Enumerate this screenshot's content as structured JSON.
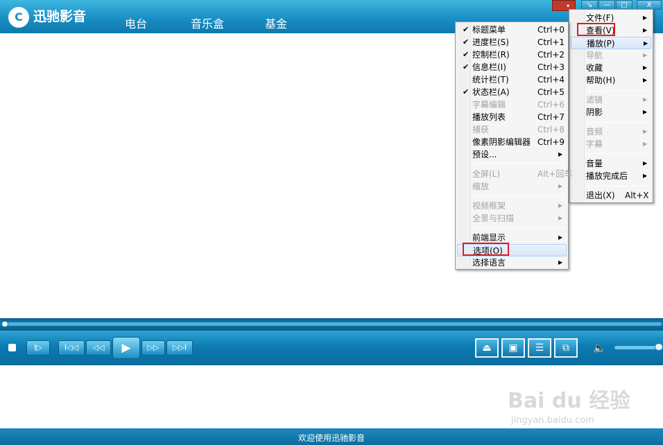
{
  "app": {
    "title": "迅驰影音",
    "logo_glyph": "C"
  },
  "nav": {
    "tabs": [
      "电台",
      "音乐盒",
      "基金"
    ]
  },
  "window_controls": {
    "menu": "▾",
    "restore": "↘",
    "minimize": "—",
    "maximize": "□",
    "close": "X"
  },
  "controls": {
    "step": "I▷",
    "prev": "I◁◁",
    "rewind": "◁◁",
    "play": "▶",
    "forward": "▷▷",
    "next": "▷▷I",
    "eject": "⏏",
    "snapshot": "▣",
    "playlist": "☰",
    "window": "⧉",
    "volume": "🔈"
  },
  "seek": {
    "position_fraction": 0.0
  },
  "volume_level": 0.85,
  "status": {
    "text": "欢迎使用迅驰影音"
  },
  "main_menu": {
    "items": [
      {
        "label": "文件(F)",
        "arrow": "▶",
        "disabled": false
      },
      {
        "label": "查看(V)",
        "arrow": "▶",
        "disabled": false
      },
      {
        "label": "播放(P)",
        "arrow": "▶",
        "disabled": false
      },
      {
        "label": "导航",
        "arrow": "▶",
        "disabled": true
      },
      {
        "label": "收藏",
        "arrow": "▶",
        "disabled": false
      },
      {
        "label": "帮助(H)",
        "arrow": "▶",
        "disabled": false
      },
      {
        "label": "滤镜",
        "arrow": "▶",
        "disabled": true
      },
      {
        "label": "阴影",
        "arrow": "▶",
        "disabled": false
      },
      {
        "label": "音频",
        "arrow": "▶",
        "disabled": true
      },
      {
        "label": "字幕",
        "arrow": "▶",
        "disabled": true
      },
      {
        "label": "音量",
        "arrow": "▶",
        "disabled": false
      },
      {
        "label": "播放完成后",
        "arrow": "▶",
        "disabled": false
      },
      {
        "label": "退出(X)",
        "shortcut": "Alt+X",
        "disabled": false
      }
    ]
  },
  "view_menu": {
    "items": [
      {
        "label": "标题菜单",
        "shortcut": "Ctrl+0",
        "check": "✔",
        "disabled": false
      },
      {
        "label": "进度栏(S)",
        "shortcut": "Ctrl+1",
        "check": "✔",
        "disabled": false
      },
      {
        "label": "控制栏(R)",
        "shortcut": "Ctrl+2",
        "check": "✔",
        "disabled": false
      },
      {
        "label": "信息栏(I)",
        "shortcut": "Ctrl+3",
        "check": "✔",
        "disabled": false
      },
      {
        "label": "统计栏(T)",
        "shortcut": "Ctrl+4",
        "disabled": false
      },
      {
        "label": "状态栏(A)",
        "shortcut": "Ctrl+5",
        "check": "✔",
        "disabled": false
      },
      {
        "label": "字幕编辑",
        "shortcut": "Ctrl+6",
        "disabled": true
      },
      {
        "label": "播放列表",
        "shortcut": "Ctrl+7",
        "disabled": false
      },
      {
        "label": "捕获",
        "shortcut": "Ctrl+8",
        "disabled": true
      },
      {
        "label": "像素阴影编辑器",
        "shortcut": "Ctrl+9",
        "disabled": false
      },
      {
        "label": "预设...",
        "arrow": "▶",
        "disabled": false
      },
      {
        "label": "全屏(L)",
        "shortcut": "Alt+回车",
        "disabled": true
      },
      {
        "label": "缩放",
        "arrow": "▶",
        "disabled": true
      },
      {
        "label": "视频框架",
        "arrow": "▶",
        "disabled": true
      },
      {
        "label": "全景与扫描",
        "arrow": "▶",
        "disabled": true
      },
      {
        "label": "前端显示",
        "arrow": "▶",
        "disabled": false
      },
      {
        "label": "选项(O)",
        "disabled": false
      },
      {
        "label": "选择语言",
        "arrow": "▶",
        "disabled": false
      }
    ]
  },
  "watermark": {
    "line1": "Bai du 经验",
    "line2": "jingyan.baidu.com"
  },
  "colors": {
    "accent": "#1a8fc4",
    "highlight_box": "#e01b1b"
  }
}
